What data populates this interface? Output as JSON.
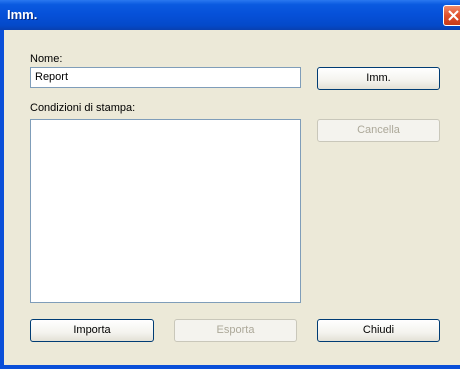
{
  "window": {
    "title": "Imm."
  },
  "form": {
    "name_label": "Nome:",
    "name_value": "Report",
    "conditions_label": "Condizioni di stampa:",
    "conditions_items": []
  },
  "buttons": {
    "imm": "Imm.",
    "cancella": "Cancella",
    "importa": "Importa",
    "esporta": "Esporta",
    "chiudi": "Chiudi"
  },
  "colors": {
    "titlebar": "#0650d8",
    "dialog_bg": "#ece9d8",
    "close_button": "#e0502c",
    "field_border": "#7f9db9",
    "button_border": "#003c74",
    "disabled_text": "#aca899"
  }
}
